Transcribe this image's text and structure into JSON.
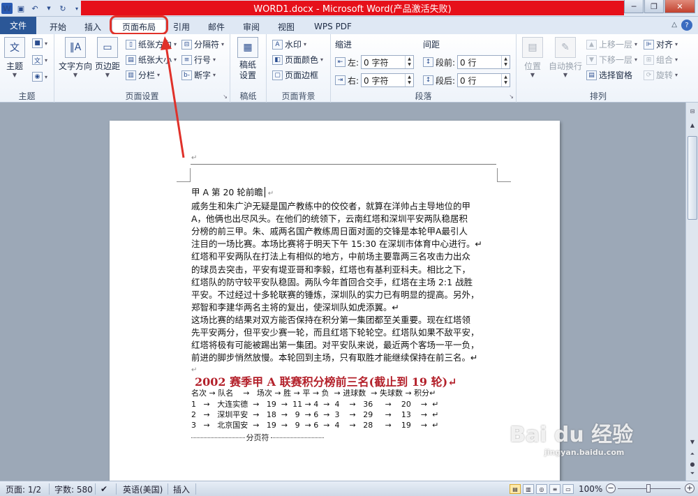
{
  "window": {
    "title": "WORD1.docx - Microsoft Word(产品激活失败)"
  },
  "tabs": {
    "file": "文件",
    "home": "开始",
    "insert": "插入",
    "page_layout": "页面布局",
    "references": "引用",
    "mailings": "邮件",
    "review": "审阅",
    "view": "视图",
    "wps_pdf": "WPS PDF"
  },
  "ribbon": {
    "themes": {
      "label": "主题",
      "themes_btn": "主题"
    },
    "page_setup": {
      "label": "页面设置",
      "text_direction": "文字方向",
      "margins": "页边距",
      "orientation": "纸张方向",
      "size": "纸张大小",
      "columns": "分栏",
      "breaks": "分隔符",
      "line_numbers": "行号",
      "hyphenation": "断字"
    },
    "manuscript": {
      "label": "稿纸",
      "settings": "稿纸\n设置"
    },
    "page_background": {
      "label": "页面背景",
      "watermark": "水印",
      "page_color": "页面颜色",
      "page_borders": "页面边框"
    },
    "paragraph": {
      "label": "段落",
      "indent": "缩进",
      "spacing": "间距",
      "left": "左:",
      "right": "右:",
      "before": "段前:",
      "after": "段后:",
      "left_value": "0 字符",
      "right_value": "0 字符",
      "before_value": "0 行",
      "after_value": "0 行"
    },
    "arrange": {
      "label": "排列",
      "position": "位置",
      "wrap_text": "自动换行",
      "bring_forward": "上移一层",
      "send_backward": "下移一层",
      "selection_pane": "选择窗格",
      "align": "对齐",
      "group": "组合",
      "rotate": "旋转"
    }
  },
  "document": {
    "header_mark": "↵",
    "paragraphs": [
      "甲 A 第 20 轮前瞻",
      "戚务生和朱广沪无疑是国产教练中的佼佼者，就算在洋帅占主导地位的甲",
      "A，他俩也出尽风头。在他们的统领下，云南红塔和深圳平安两队稳居积",
      "分榜的前三甲。朱、戚两名国产教练周日面对面的交锋是本轮甲A最引人",
      "注目的一场比赛。本场比赛将于明天下午 15:30 在深圳市体育中心进行。↵",
      "红塔和平安两队在打法上有相似的地方，中前场主要靠两三名攻击力出众",
      "的球员去突击，平安有堤亚哥和李毅，红塔也有基利亚科夫。相比之下，",
      "红塔队的防守较平安队稳固。两队今年首回合交手，红塔在主场 2:1 战胜",
      "平安。不过经过十多轮联赛的锤炼，深圳队的实力已有明显的提高。另外，",
      "郑智和李建华两名主将的复出，使深圳队如虎添翼。↵",
      "这场比赛的结果对双方能否保持在积分第一集团都至关重要。现在红塔领",
      "先平安两分，但平安少赛一轮，而且红塔下轮轮空。红塔队如果不敌平安，",
      "红塔将极有可能被踢出第一集团。对平安队来说，最近两个客场一平一负，",
      "前进的脚步悄然放慢。本轮回到主场，只有取胜才能继续保持在前三名。↵",
      "↵"
    ],
    "heading": "2002 赛季甲 A 联赛积分榜前三名(截止到 19 轮)↵",
    "table_header": "名次 → 队名    →   场次 → 胜 → 平 → 负  → 进球数  → 失球数 → 积分↵",
    "table_rows": [
      "1   →   大连实德  →   19  →  11 → 4  →  4    →   36     →    20    →  ↵",
      "2   →   深圳平安  →   18  →   9  → 6  →  3    →   29     →    13    →  ↵",
      "3   →   北京国安  →   19  →   9  → 6  →  4    →   28     →    19    →  ↵"
    ],
    "page_break": "分页符"
  },
  "status": {
    "page": "页面: 1/2",
    "words": "字数: 580",
    "language": "英语(美国)",
    "mode": "插入",
    "zoom": "100%"
  },
  "watermark": {
    "brand": "Bai du 经验",
    "url": "jingyan.baidu.com"
  }
}
